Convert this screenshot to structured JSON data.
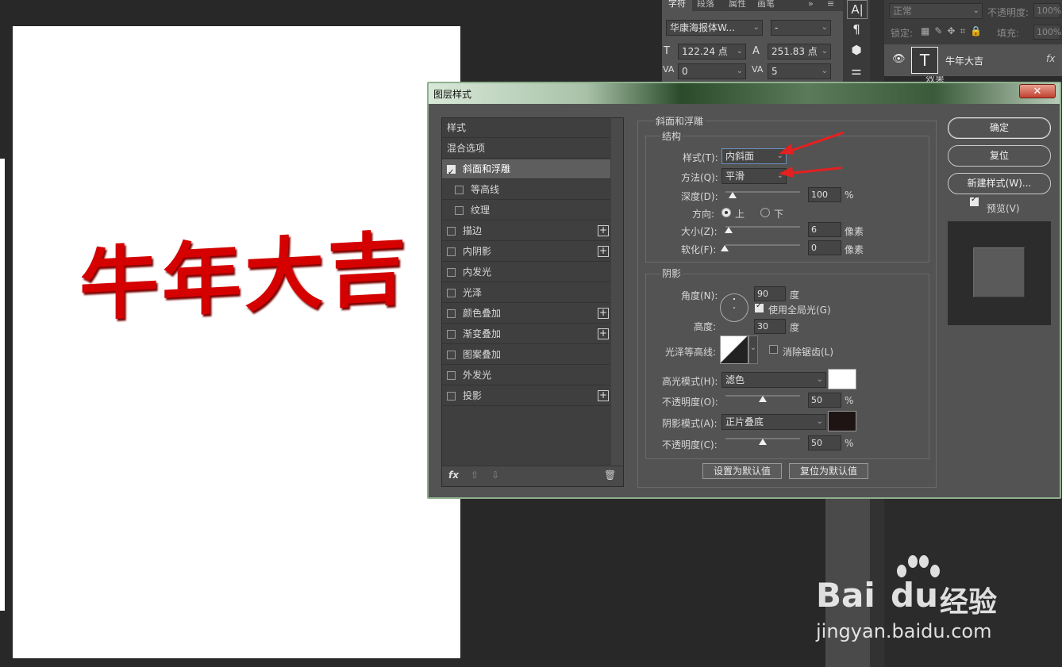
{
  "canvas": {
    "artwork_text": "牛年大吉",
    "artwork_color": "#d50000"
  },
  "char_panel": {
    "tabs": [
      "字符",
      "段落",
      "属性",
      "画笔"
    ],
    "font_family": "华康海报体W...",
    "font_style": "-",
    "font_size": "122.24 点",
    "leading": "251.83 点",
    "kerning": "0",
    "tracking": "5"
  },
  "layers_panel": {
    "blend_mode": "正常",
    "opacity_label": "不透明度:",
    "opacity_value": "100%",
    "lock_label": "锁定:",
    "fill_label": "填充:",
    "fill_value": "100%",
    "layer_name": "牛年大吉",
    "layer_fx": "fx",
    "effects_label": "效果"
  },
  "dialog": {
    "title": "图层样式",
    "close": "✕",
    "sidebar": [
      {
        "label": "样式",
        "checkbox": false,
        "checked": false,
        "plus": false,
        "indent": 0
      },
      {
        "label": "混合选项",
        "checkbox": false,
        "checked": false,
        "plus": false,
        "indent": 0
      },
      {
        "label": "斜面和浮雕",
        "checkbox": true,
        "checked": true,
        "plus": false,
        "indent": 0
      },
      {
        "label": "等高线",
        "checkbox": true,
        "checked": false,
        "plus": false,
        "indent": 1
      },
      {
        "label": "纹理",
        "checkbox": true,
        "checked": false,
        "plus": false,
        "indent": 1
      },
      {
        "label": "描边",
        "checkbox": true,
        "checked": false,
        "plus": true,
        "indent": 0
      },
      {
        "label": "内阴影",
        "checkbox": true,
        "checked": false,
        "plus": true,
        "indent": 0
      },
      {
        "label": "内发光",
        "checkbox": true,
        "checked": false,
        "plus": false,
        "indent": 0
      },
      {
        "label": "光泽",
        "checkbox": true,
        "checked": false,
        "plus": false,
        "indent": 0
      },
      {
        "label": "颜色叠加",
        "checkbox": true,
        "checked": false,
        "plus": true,
        "indent": 0
      },
      {
        "label": "渐变叠加",
        "checkbox": true,
        "checked": false,
        "plus": true,
        "indent": 0
      },
      {
        "label": "图案叠加",
        "checkbox": true,
        "checked": false,
        "plus": false,
        "indent": 0
      },
      {
        "label": "外发光",
        "checkbox": true,
        "checked": false,
        "plus": false,
        "indent": 0
      },
      {
        "label": "投影",
        "checkbox": true,
        "checked": false,
        "plus": true,
        "indent": 0
      }
    ],
    "footer": {
      "fx": "fx",
      "up": "⇧",
      "down": "⇩",
      "trash": "🗑"
    },
    "bevel": {
      "section_title": "斜面和浮雕",
      "structure_title": "结构",
      "style_label": "样式(T):",
      "style_value": "内斜面",
      "technique_label": "方法(Q):",
      "technique_value": "平滑",
      "depth_label": "深度(D):",
      "depth_value": "100",
      "depth_unit": "%",
      "depth_level": 0.08,
      "direction_label": "方向:",
      "dir_up": "上",
      "dir_down": "下",
      "size_label": "大小(Z):",
      "size_value": "6",
      "size_unit": "像素",
      "soften_label": "软化(F):",
      "soften_value": "0",
      "soften_unit": "像素"
    },
    "shading": {
      "title": "阴影",
      "angle_label": "角度(N):",
      "angle_value": "90",
      "angle_unit": "度",
      "global_light_label": "使用全局光(G)",
      "altitude_label": "高度:",
      "altitude_value": "30",
      "altitude_unit": "度",
      "gloss_label": "光泽等高线:",
      "antialias_label": "消除锯齿(L)",
      "highlight_label": "高光模式(H):",
      "highlight_mode": "滤色",
      "highlight_color": "#ffffff",
      "hl_opacity_label": "不透明度(O):",
      "hl_opacity_value": "50",
      "shadow_label": "阴影模式(A):",
      "shadow_mode": "正片叠底",
      "shadow_color": "#1e1414",
      "sh_opacity_label": "不透明度(C):",
      "sh_opacity_value": "50",
      "percent": "%"
    },
    "make_default": "设置为默认值",
    "reset_default": "复位为默认值",
    "buttons": {
      "ok": "确定",
      "reset": "复位",
      "new_style": "新建样式(W)...",
      "preview": "预览(V)"
    }
  },
  "watermark": {
    "brand": "Bai",
    "brand2": "du",
    "suffix": "经验",
    "url": "jingyan.baidu.com"
  }
}
